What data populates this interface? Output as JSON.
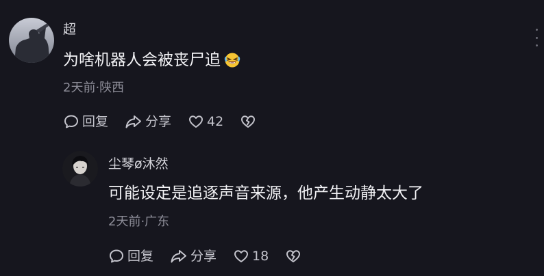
{
  "comment": {
    "user_name": "超",
    "text": "为啥机器人会被丧尸追",
    "emoji_icon": "rolling-on-floor-laughing-icon",
    "time_location": "2天前·陕西",
    "reply_label": "回复",
    "share_label": "分享",
    "like_count": "42"
  },
  "reply": {
    "user_name": "尘琴ø沐然",
    "text": "可能设定是追逐声音来源，他产生动静太大了",
    "time_location": "2天前·广东",
    "reply_label": "回复",
    "share_label": "分享",
    "like_count": "18"
  },
  "colors": {
    "background": "#16161e",
    "primary_text": "#f2f2f5",
    "secondary_text": "#8d8d98",
    "action_text": "#c4c4cc"
  }
}
